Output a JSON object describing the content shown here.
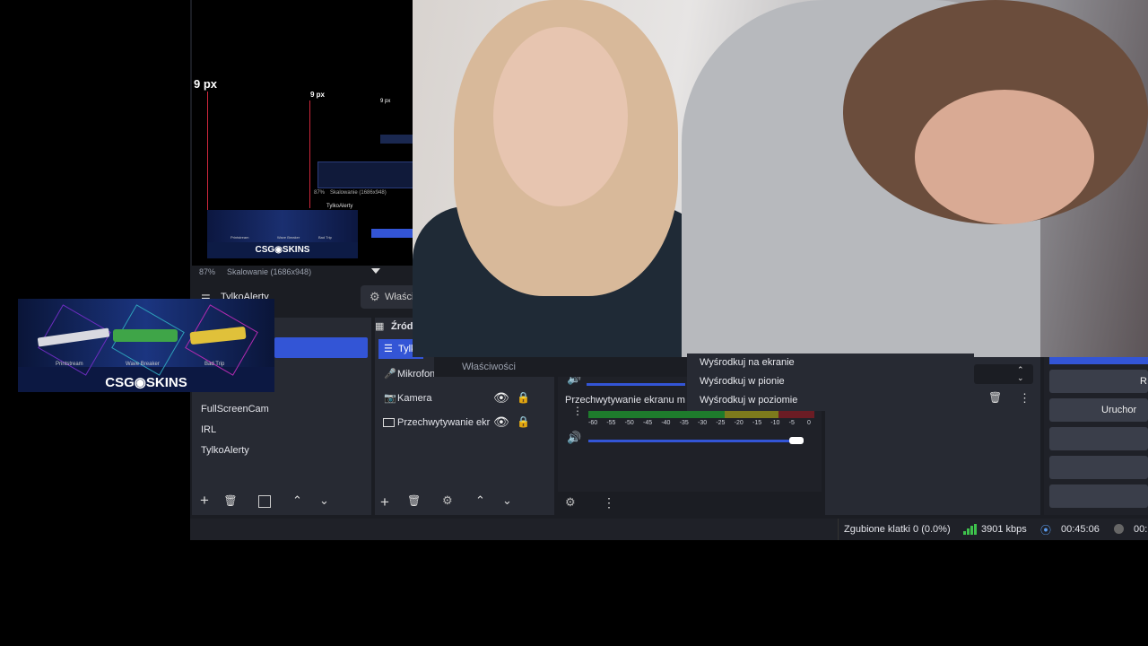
{
  "preview": {
    "px_label_big": "9 px",
    "px_label_mid": "9 px",
    "px_label_small": "9 px",
    "zoom": "87%",
    "scaling": "Skalowanie (1686x948)",
    "mini_zoom": "87%",
    "mini_scaling": "Skalowanie (1686x948)",
    "mini_label": "TylkoAlerty"
  },
  "overlay_card": {
    "brand": "CSG◉SKINS",
    "weapons": [
      "Printstream",
      "Wave Breaker",
      "Bad Trip"
    ]
  },
  "mini_card": {
    "brand": "CSG◉SKINS",
    "weapons": [
      "Printstream",
      "Wave Breaker",
      "Bad Trip"
    ]
  },
  "scenes": {
    "current_scene": "TylkoAlerty",
    "properties_button": "Właściwości",
    "items": [
      "FullScreenCam",
      "IRL",
      "TylkoAlerty"
    ]
  },
  "sources": {
    "title": "Źród",
    "selected": "Tylk",
    "items": [
      "Mikrofon",
      "Kamera",
      "Przechwytywanie ekr"
    ]
  },
  "context_menu_left": {
    "item": "Właściwości"
  },
  "context_menu_right": {
    "items": [
      "Wyśrodkuj na ekranie",
      "Wyśrodkuj w pionie",
      "Wyśrodkuj w poziomie"
    ]
  },
  "mixer": {
    "track_label": "Przechwytywanie ekranu m",
    "ticks": [
      "-60",
      "-55",
      "-50",
      "-45",
      "-40",
      "-35",
      "-30",
      "-25",
      "-20",
      "-15",
      "-10",
      "-5",
      "0"
    ],
    "volume_level": 1.0
  },
  "controls": {
    "button_1": "R",
    "button_2": "Uruchor"
  },
  "status": {
    "dropped": "Zgubione klatki 0 (0.0%)",
    "bitrate": "3901 kbps",
    "time": "00:45:06",
    "time2": "00:"
  },
  "colors": {
    "accent": "#3355d6",
    "panel": "#1f2128",
    "dock": "#272a33"
  }
}
